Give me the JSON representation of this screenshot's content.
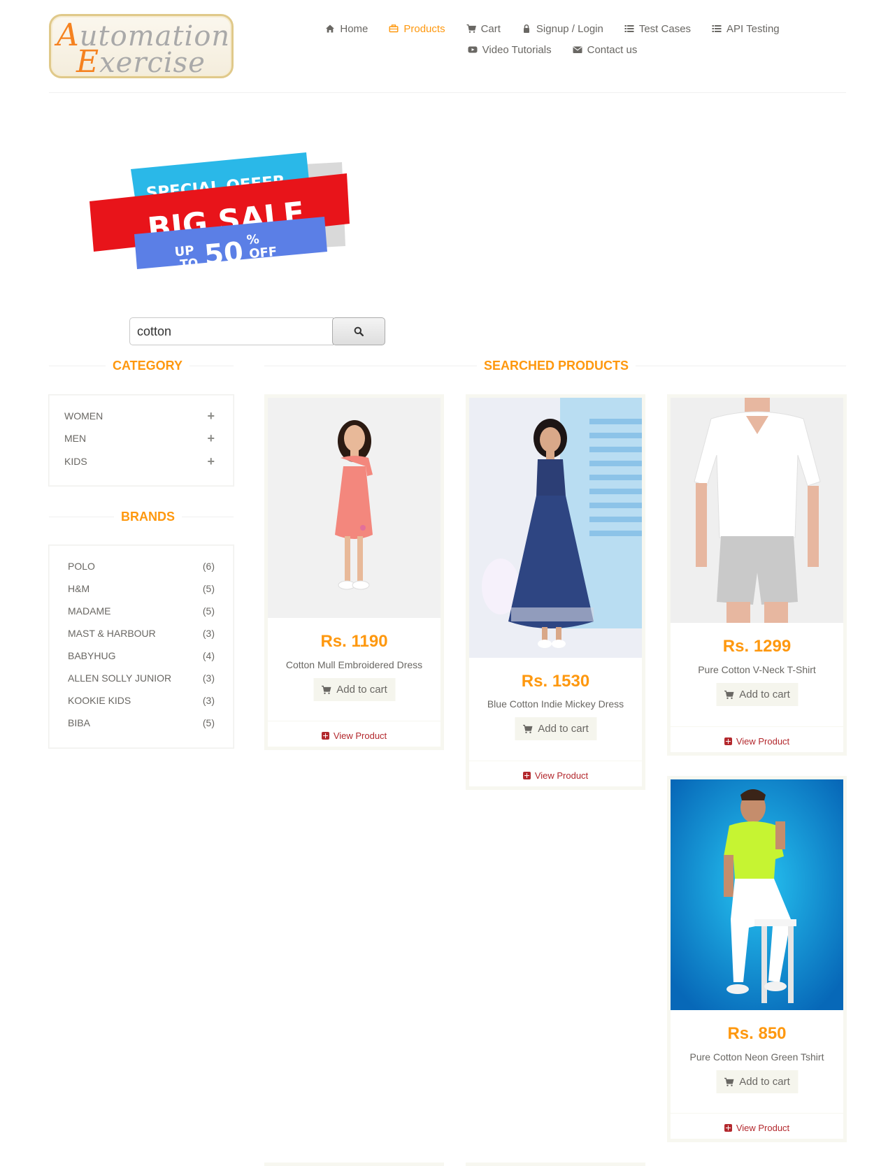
{
  "brand": {
    "logo_line1_cap": "A",
    "logo_line1": "utomation",
    "logo_line2_cap": "E",
    "logo_line2": "xercise"
  },
  "nav": {
    "items": [
      {
        "label": "Home",
        "icon": "home-icon"
      },
      {
        "label": "Products",
        "icon": "products-icon",
        "active": true
      },
      {
        "label": "Cart",
        "icon": "cart-icon"
      },
      {
        "label": "Signup / Login",
        "icon": "lock-icon"
      },
      {
        "label": "Test Cases",
        "icon": "list-icon"
      },
      {
        "label": "API Testing",
        "icon": "list-icon"
      },
      {
        "label": "Video Tutorials",
        "icon": "youtube-icon"
      },
      {
        "label": "Contact us",
        "icon": "envelope-icon"
      }
    ]
  },
  "banner": {
    "line1": "SPECIAL OFFER",
    "line2": "BIG SALE",
    "line3a": "UP",
    "line3b": "TO",
    "line3c": "50",
    "line3d": "%",
    "line3e": "OFF"
  },
  "search": {
    "value": "cotton"
  },
  "category": {
    "title": "CATEGORY",
    "items": [
      {
        "label": "WOMEN"
      },
      {
        "label": "MEN"
      },
      {
        "label": "KIDS"
      }
    ]
  },
  "brands": {
    "title": "BRANDS",
    "items": [
      {
        "label": "POLO",
        "count": "(6)"
      },
      {
        "label": "H&M",
        "count": "(5)"
      },
      {
        "label": "MADAME",
        "count": "(5)"
      },
      {
        "label": "MAST & HARBOUR",
        "count": "(3)"
      },
      {
        "label": "BABYHUG",
        "count": "(4)"
      },
      {
        "label": "ALLEN SOLLY JUNIOR",
        "count": "(3)"
      },
      {
        "label": "KOOKIE KIDS",
        "count": "(3)"
      },
      {
        "label": "BIBA",
        "count": "(5)"
      }
    ]
  },
  "products": {
    "title": "SEARCHED PRODUCTS",
    "add_label": "Add to cart",
    "view_label": "View Product",
    "items": [
      {
        "price": "Rs. 1190",
        "name": "Cotton Mull Embroidered Dress"
      },
      {
        "price": "Rs. 1530",
        "name": "Blue Cotton Indie Mickey Dress"
      },
      {
        "price": "Rs. 1299",
        "name": "Pure Cotton V-Neck T-Shirt"
      },
      {
        "price": "Rs. 850",
        "name": "Pure Cotton Neon Green Tshirt"
      }
    ]
  },
  "colors": {
    "accent": "#fe980f",
    "link": "#b3282d",
    "text": "#696763"
  }
}
